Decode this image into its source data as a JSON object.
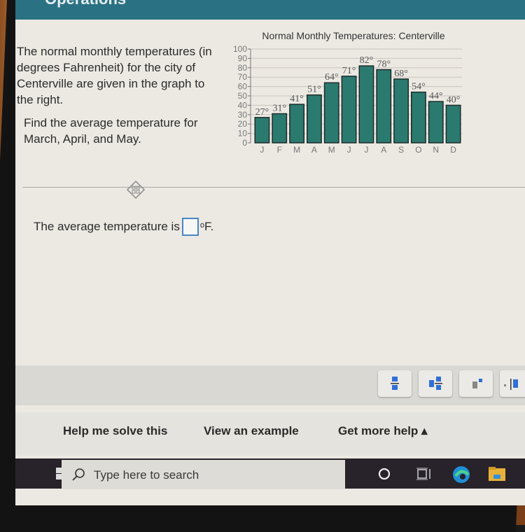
{
  "header": {
    "title": "Operations"
  },
  "problem": {
    "intro": "The normal monthly temperatures (in degrees Fahrenheit) for the city of Centerville are given in the graph to the right.",
    "task": "Find the average temperature for March, April, and May."
  },
  "answer": {
    "prefix": "The average temperature is",
    "value": "",
    "degree": "o",
    "suffix": "F."
  },
  "toolbar": {
    "buttons": [
      "fraction",
      "mixed-number",
      "exponent",
      "absolute-value"
    ]
  },
  "help": {
    "solve": "Help me solve this",
    "example": "View an example",
    "more": "Get more help ▴"
  },
  "taskbar": {
    "search_placeholder": "Type here to search"
  },
  "colors": {
    "header": "#2a7183",
    "bar": "#2b7a6f",
    "input_border": "#4a86c6"
  },
  "chart_data": {
    "type": "bar",
    "title": "Normal Monthly Temperatures: Centerville",
    "categories": [
      "J",
      "F",
      "M",
      "A",
      "M",
      "J",
      "J",
      "A",
      "S",
      "O",
      "N",
      "D"
    ],
    "values": [
      27,
      31,
      41,
      51,
      64,
      71,
      82,
      78,
      68,
      54,
      44,
      40
    ],
    "data_labels": [
      "27°",
      "31°",
      "41°",
      "51°",
      "64°",
      "71°",
      "82°",
      "78°",
      "68°",
      "54°",
      "44°",
      "40°"
    ],
    "yticks": [
      0,
      10,
      20,
      30,
      40,
      50,
      60,
      70,
      80,
      90,
      100
    ],
    "ylim": [
      0,
      100
    ],
    "xlabel": "",
    "ylabel": "",
    "grid": true
  }
}
